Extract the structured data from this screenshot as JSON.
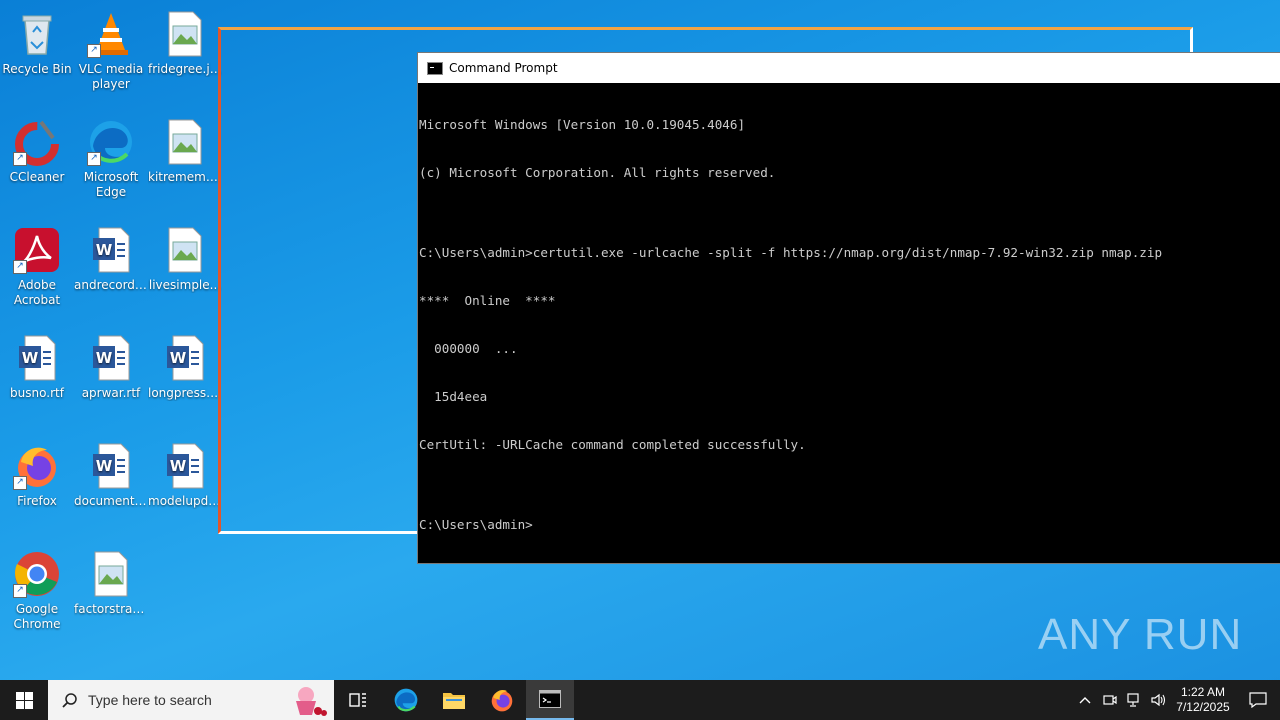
{
  "desktop": {
    "icons": [
      {
        "label": "Recycle Bin"
      },
      {
        "label": "VLC media player"
      },
      {
        "label": "fridegree.jpg"
      },
      {
        "label": "CCleaner"
      },
      {
        "label": "Microsoft Edge"
      },
      {
        "label": "kitremember..."
      },
      {
        "label": "Adobe Acrobat"
      },
      {
        "label": "andrecords..."
      },
      {
        "label": "livesimple..."
      },
      {
        "label": "busno.rtf"
      },
      {
        "label": "aprwar.rtf"
      },
      {
        "label": "longpressur..."
      },
      {
        "label": "Firefox"
      },
      {
        "label": "documents..."
      },
      {
        "label": "modelupda..."
      },
      {
        "label": "Google Chrome"
      },
      {
        "label": "factorstrad..."
      }
    ]
  },
  "cmd": {
    "title": "Command Prompt",
    "lines": [
      "Microsoft Windows [Version 10.0.19045.4046]",
      "(c) Microsoft Corporation. All rights reserved.",
      "",
      "C:\\Users\\admin>certutil.exe -urlcache -split -f https://nmap.org/dist/nmap-7.92-win32.zip nmap.zip",
      "****  Online  ****",
      "  000000  ...",
      "  15d4eea",
      "CertUtil: -URLCache command completed successfully.",
      "",
      "C:\\Users\\admin>"
    ]
  },
  "watermark": {
    "text": "ANY RUN"
  },
  "taskbar": {
    "search_placeholder": "Type here to search",
    "clock_time": "1:22 AM",
    "clock_date": "7/12/2025"
  },
  "colors": {
    "accent": "#0a7fd6",
    "taskbar": "#1c1c1c"
  }
}
